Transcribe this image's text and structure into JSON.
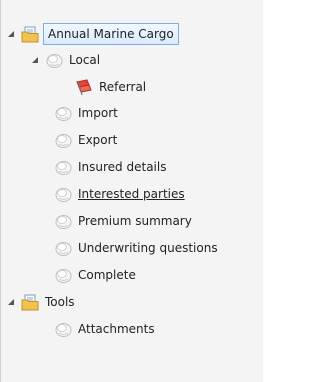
{
  "tree": {
    "root": {
      "label": "Annual Marine Cargo",
      "icon": "folder-document-icon",
      "expanded": true,
      "selected": true
    },
    "local": {
      "label": "Local",
      "icon": "tasks-icon",
      "expanded": true
    },
    "referral": {
      "label": "Referral",
      "icon": "flag-icon"
    },
    "steps": [
      {
        "label": "Import",
        "icon": "tasks-icon"
      },
      {
        "label": "Export",
        "icon": "tasks-icon"
      },
      {
        "label": "Insured details",
        "icon": "tasks-icon"
      },
      {
        "label": "Interested parties",
        "icon": "tasks-icon",
        "underlined": true
      },
      {
        "label": "Premium summary",
        "icon": "tasks-icon"
      },
      {
        "label": "Underwriting questions",
        "icon": "tasks-icon"
      },
      {
        "label": "Complete",
        "icon": "tasks-icon"
      }
    ],
    "tools": {
      "label": "Tools",
      "icon": "folder-document-icon",
      "expanded": true
    },
    "attachments": {
      "label": "Attachments",
      "icon": "tasks-icon"
    }
  },
  "colors": {
    "selection_border": "#84acdd",
    "selection_fill": "#dbeaff",
    "folder_yellow": "#f2c24e",
    "referral_red": "#e2453a"
  }
}
